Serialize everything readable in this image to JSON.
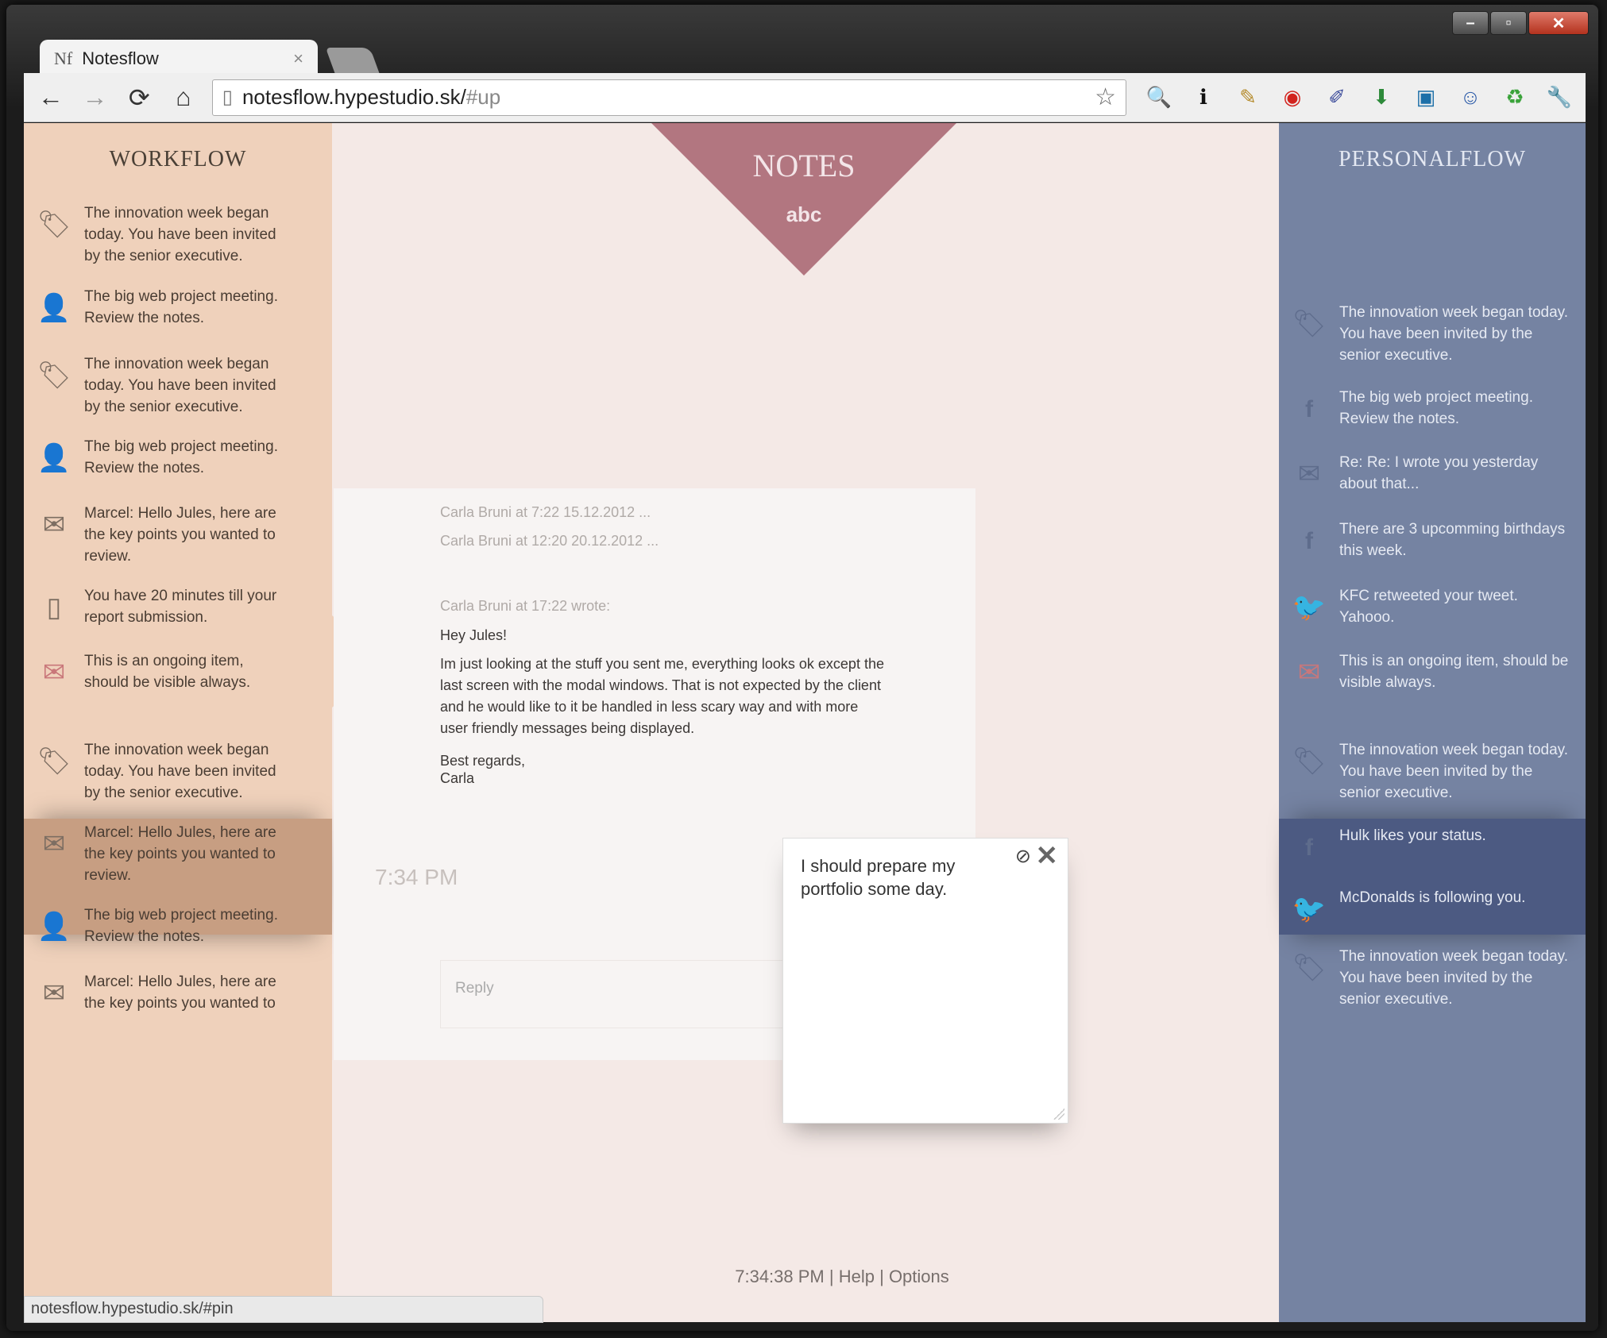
{
  "window": {
    "minimize": "–",
    "maximize": "▫",
    "close": "✕"
  },
  "tab": {
    "favicon": "Nf",
    "title": "Notesflow",
    "close": "×"
  },
  "toolbar": {
    "back": "←",
    "forward": "→",
    "reload": "⟳",
    "home": "⌂",
    "url_main": "notesflow.hypestudio.sk/",
    "url_hash": "#up",
    "star": "☆",
    "extensions": [
      {
        "name": "magnifier-icon",
        "glyph": "🔍",
        "color": "#2a6fb5"
      },
      {
        "name": "info-icon",
        "glyph": "ℹ",
        "color": "#111"
      },
      {
        "name": "notepad-icon",
        "glyph": "✎",
        "color": "#b48a2a"
      },
      {
        "name": "opera-icon",
        "glyph": "◉",
        "color": "#d2231e"
      },
      {
        "name": "eyedropper-icon",
        "glyph": "✐",
        "color": "#3a4a9a"
      },
      {
        "name": "download-icon",
        "glyph": "⬇",
        "color": "#2d8a3a"
      },
      {
        "name": "css-icon",
        "glyph": "▣",
        "color": "#1c6fa8"
      },
      {
        "name": "smiley-icon",
        "glyph": "☺",
        "color": "#2b5aa8"
      },
      {
        "name": "recycle-icon",
        "glyph": "♻",
        "color": "#3aa33a"
      },
      {
        "name": "wrench-icon",
        "glyph": "🔧",
        "color": "#555"
      }
    ]
  },
  "workflow": {
    "title": "WORKFLOW",
    "items": [
      {
        "icon": "tag-icon",
        "glyph": "🏷",
        "text": "The innovation week began today. You have been invited by the senior executive."
      },
      {
        "icon": "person-icon",
        "glyph": "👤",
        "text": "The big web project meeting. Review the notes."
      },
      {
        "icon": "tag-icon",
        "glyph": "🏷",
        "text": "The innovation week began today. You have been invited by the senior executive."
      },
      {
        "icon": "person-icon",
        "glyph": "👤",
        "text": "The big web project meeting. Review the notes."
      },
      {
        "icon": "mail-icon",
        "glyph": "✉",
        "text": "Marcel: Hello Jules, here are the key points you wanted to review."
      },
      {
        "icon": "document-icon",
        "glyph": "▯",
        "text": "You have 20 minutes till your report submission."
      },
      {
        "icon": "mail-icon",
        "glyph": "✉",
        "text": "This is an ongoing item, should be visible always."
      },
      {
        "icon": "tag-icon",
        "glyph": "🏷",
        "text": "The innovation week began today. You have been invited by the senior executive."
      },
      {
        "icon": "mail-icon",
        "glyph": "✉",
        "text": "Marcel: Hello Jules, here are the key points you wanted to review."
      },
      {
        "icon": "person-icon",
        "glyph": "👤",
        "text": "The big web project meeting. Review the notes."
      },
      {
        "icon": "mail-icon",
        "glyph": "✉",
        "text": "Marcel: Hello Jules, here are the key points you wanted to"
      }
    ]
  },
  "personal": {
    "title": "PERSONALFLOW",
    "items": [
      {
        "icon": "tag-icon",
        "glyph": "🏷",
        "text": "The innovation week began today. You have been invited by the senior executive."
      },
      {
        "icon": "facebook-icon",
        "glyph": "f",
        "text": "The big web project meeting. Review the notes."
      },
      {
        "icon": "mail-icon",
        "glyph": "✉",
        "text": "Re: Re: I wrote you yesterday about that..."
      },
      {
        "icon": "facebook-icon",
        "glyph": "f",
        "text": "There are 3 upcomming birthdays this week."
      },
      {
        "icon": "twitter-icon",
        "glyph": "🐦",
        "text": "KFC retweeted your tweet. Yahooo."
      },
      {
        "icon": "mail-icon",
        "glyph": "✉",
        "text": "This is an ongoing item, should be visible always."
      },
      {
        "icon": "tag-icon",
        "glyph": "🏷",
        "text": "The innovation week began today. You have been invited by the senior executive."
      },
      {
        "icon": "facebook-icon",
        "glyph": "f",
        "text": "Hulk likes your status."
      },
      {
        "icon": "twitter-icon",
        "glyph": "🐦",
        "text": "McDonalds is following you."
      },
      {
        "icon": "tag-icon",
        "glyph": "🏷",
        "text": "The innovation week began today. You have been invited by the senior executive."
      }
    ]
  },
  "notes": {
    "title": "NOTES",
    "sub": "abc"
  },
  "message": {
    "history1": "Carla Bruni at 7:22 15.12.2012 ...",
    "history2": "Carla Bruni at 12:20 20.12.2012 ...",
    "wrote": "Carla Bruni at 17:22 wrote:",
    "greeting": "Hey Jules!",
    "body": "Im just looking at the stuff you sent me, everything looks ok except the last screen with the modal windows. That is not expected by the client and he would like to it be handled in less scary way and with more user friendly messages being displayed.",
    "signoff1": "Best regards,",
    "signoff2": "Carla",
    "time": "7:34 PM",
    "reply_placeholder": "Reply"
  },
  "sticky": {
    "text": "I should prepare my portfolio some day.",
    "pin": "⊘",
    "close": "✕"
  },
  "footer": {
    "time": "7:34:38 PM",
    "sep": "|",
    "help": "Help",
    "options": "Options"
  },
  "status": {
    "url": "notesflow.hypestudio.sk/#pin"
  }
}
